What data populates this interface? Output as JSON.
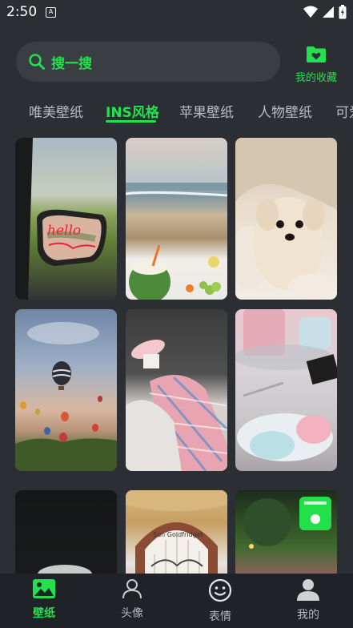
{
  "status_bar": {
    "time": "2:50",
    "app_icon": "A"
  },
  "search": {
    "label": "搜一搜"
  },
  "favorites": {
    "label": "我的收藏"
  },
  "tabs": [
    {
      "label": "唯美壁纸"
    },
    {
      "label": "INS风格"
    },
    {
      "label": "苹果壁纸"
    },
    {
      "label": "人物壁纸"
    },
    {
      "label": "可爱"
    }
  ],
  "wallpapers": {
    "car_mirror_text": "hello",
    "arch_sign_text": "Sun Goldfridget"
  },
  "bottom_nav": [
    {
      "label": "壁纸"
    },
    {
      "label": "头像"
    },
    {
      "label": "表情"
    },
    {
      "label": "我的"
    }
  ],
  "colors": {
    "accent": "#23e04f",
    "background": "#2b2f33",
    "search_bg": "#3a3d42",
    "nav_bg": "#1f2226",
    "inactive_text": "#b9bcc0"
  },
  "icons": {
    "search": "search-icon",
    "favorites": "heart-folder-icon",
    "nav_wallpaper": "image-icon",
    "nav_avatar": "person-outline-icon",
    "nav_emoji": "smiley-icon",
    "nav_mine": "person-filled-icon",
    "status_wifi": "wifi-icon",
    "status_signal": "signal-icon",
    "status_battery": "battery-icon"
  }
}
